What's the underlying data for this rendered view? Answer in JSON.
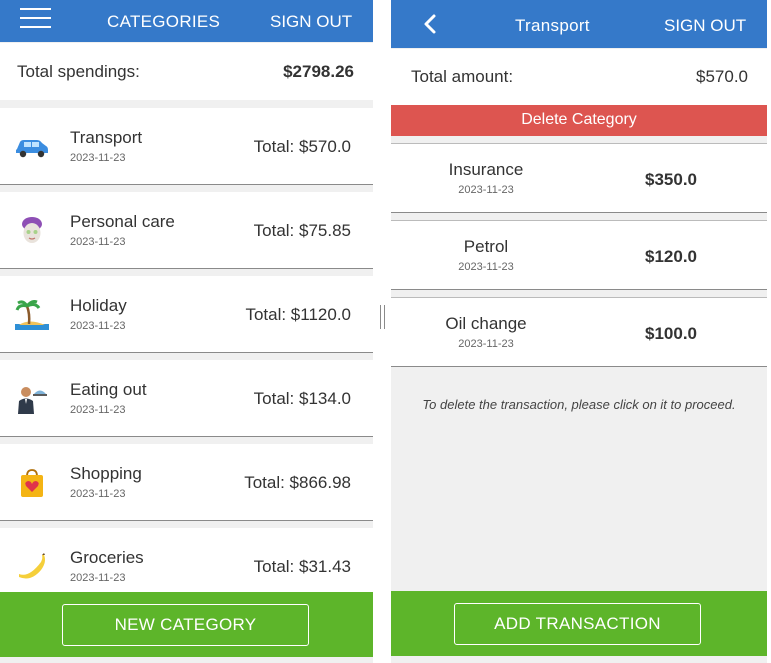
{
  "left": {
    "header": {
      "title": "CATEGORIES",
      "sign_out": "SIGN OUT"
    },
    "total": {
      "label": "Total spendings:",
      "amount": "$2798.26"
    },
    "categories": [
      {
        "name": "Transport",
        "date": "2023-11-23",
        "total": "Total: $570.0",
        "icon": "car-icon"
      },
      {
        "name": "Personal care",
        "date": "2023-11-23",
        "total": "Total: $75.85",
        "icon": "face-mask-icon"
      },
      {
        "name": "Holiday",
        "date": "2023-11-23",
        "total": "Total: $1120.0",
        "icon": "palm-beach-icon"
      },
      {
        "name": "Eating out",
        "date": "2023-11-23",
        "total": "Total: $134.0",
        "icon": "waiter-icon"
      },
      {
        "name": "Shopping",
        "date": "2023-11-23",
        "total": "Total: $866.98",
        "icon": "shopping-bag-icon"
      },
      {
        "name": "Groceries",
        "date": "2023-11-23",
        "total": "Total: $31.43",
        "icon": "banana-icon"
      }
    ],
    "new_category": "NEW CATEGORY"
  },
  "right": {
    "header": {
      "title": "Transport",
      "sign_out": "SIGN OUT"
    },
    "total": {
      "label": "Total amount:",
      "amount": "$570.0"
    },
    "delete_label": "Delete Category",
    "transactions": [
      {
        "name": "Insurance",
        "date": "2023-11-23",
        "amount": "$350.0"
      },
      {
        "name": "Petrol",
        "date": "2023-11-23",
        "amount": "$120.0"
      },
      {
        "name": "Oil change",
        "date": "2023-11-23",
        "amount": "$100.0"
      }
    ],
    "hint": "To delete the transaction, please click on it to proceed.",
    "add_transaction": "ADD TRANSACTION"
  },
  "colors": {
    "header": "#3579c9",
    "action": "#5db52a",
    "danger": "#dd5550"
  }
}
